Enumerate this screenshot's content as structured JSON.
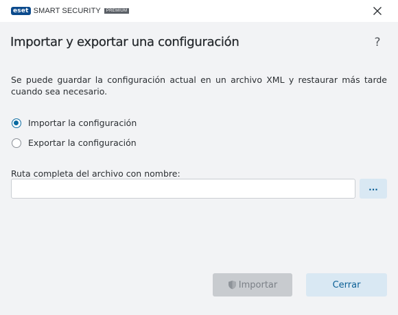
{
  "titlebar": {
    "brand": "eset",
    "product": "SMART SECURITY",
    "edition": "PREMIUM"
  },
  "header": {
    "title": "Importar y exportar una configuración",
    "help": "?"
  },
  "description": "Se puede guardar la configuración actual en un archivo XML y restaurar más tarde cuando sea necesario.",
  "options": {
    "import_label": "Importar la configuración",
    "export_label": "Exportar la configuración",
    "selected": "import"
  },
  "path": {
    "label": "Ruta completa del archivo con nombre:",
    "value": "",
    "browse_label": "..."
  },
  "buttons": {
    "import_label": "Importar",
    "close_label": "Cerrar"
  },
  "colors": {
    "accent": "#0a6aa1",
    "brand": "#0b4a8c",
    "secondary_button": "#d9e8f3",
    "disabled_button": "#c8cbcf"
  }
}
